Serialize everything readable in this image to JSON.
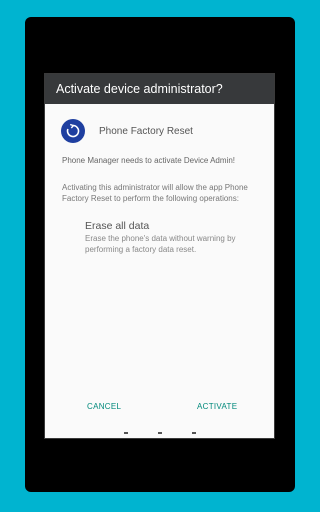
{
  "dialog": {
    "title": "Activate device administrator?",
    "app_name": "Phone Factory Reset",
    "request_message": "Phone Manager needs to activate Device Admin!",
    "description": "Activating this administrator will allow the app Phone Factory Reset to perform the following operations:",
    "policy": {
      "title": "Erase all data",
      "description": "Erase the phone's data without warning by performing a factory data reset."
    },
    "buttons": {
      "cancel": "CANCEL",
      "activate": "ACTIVATE"
    }
  },
  "icons": {
    "app_icon": "refresh-icon"
  },
  "colors": {
    "background": "#00b4d0",
    "title_bar": "#37393b",
    "accent": "#00897b",
    "app_icon_bg": "#1f3fa0"
  }
}
